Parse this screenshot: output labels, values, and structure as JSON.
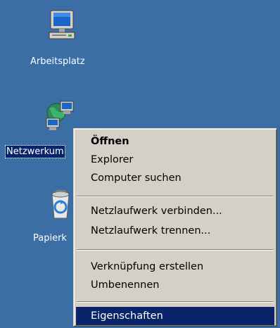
{
  "desktop": {
    "background_color": "#3a6ea5",
    "icons": [
      {
        "label": "Arbeitsplatz",
        "icon": "my-computer-icon"
      },
      {
        "label": "Netzwerkum",
        "icon": "network-neighborhood-icon",
        "selected": true
      },
      {
        "label": "Papierk",
        "icon": "recycle-bin-icon"
      }
    ]
  },
  "context_menu": {
    "items": [
      {
        "label": "Öffnen",
        "bold": true
      },
      {
        "label": "Explorer"
      },
      {
        "label": "Computer suchen"
      },
      {
        "label": "Netzlaufwerk verbinden..."
      },
      {
        "label": "Netzlaufwerk trennen..."
      },
      {
        "label": "Verknüpfung erstellen"
      },
      {
        "label": "Umbenennen"
      },
      {
        "label": "Eigenschaften",
        "highlighted": true
      }
    ],
    "highlight_color": "#0a246a"
  }
}
